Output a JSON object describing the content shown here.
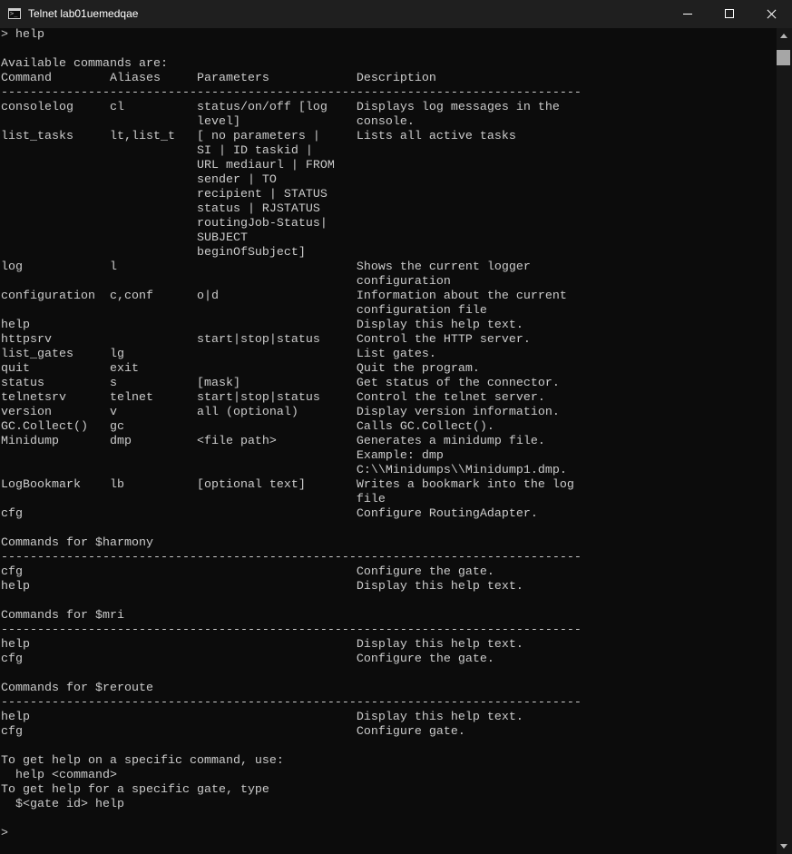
{
  "window": {
    "title": "Telnet lab01uemedqae",
    "app_icon": "console-icon",
    "controls": {
      "minimize": "minimize-icon",
      "maximize": "maximize-icon",
      "close": "close-icon"
    }
  },
  "terminal": {
    "background": "#0c0c0c",
    "foreground": "#cccccc",
    "lines": [
      "> help",
      "",
      "Available commands are:",
      "Command        Aliases     Parameters            Description",
      "--------------------------------------------------------------------------------",
      "consolelog     cl          status/on/off [log    Displays log messages in the",
      "                           level]                console.",
      "list_tasks     lt,list_t   [ no parameters |     Lists all active tasks",
      "                           SI | ID taskid |",
      "                           URL mediaurl | FROM",
      "                           sender | TO",
      "                           recipient | STATUS",
      "                           status | RJSTATUS",
      "                           routingJob-Status|",
      "                           SUBJECT",
      "                           beginOfSubject]",
      "log            l                                 Shows the current logger",
      "                                                 configuration",
      "configuration  c,conf      o|d                   Information about the current",
      "                                                 configuration file",
      "help                                             Display this help text.",
      "httpsrv                    start|stop|status     Control the HTTP server.",
      "list_gates     lg                                List gates.",
      "quit           exit                              Quit the program.",
      "status         s           [mask]                Get status of the connector.",
      "telnetsrv      telnet      start|stop|status     Control the telnet server.",
      "version        v           all (optional)        Display version information.",
      "GC.Collect()   gc                                Calls GC.Collect().",
      "Minidump       dmp         <file path>           Generates a minidump file.",
      "                                                 Example: dmp",
      "                                                 C:\\\\Minidumps\\\\Minidump1.dmp.",
      "LogBookmark    lb          [optional text]       Writes a bookmark into the log",
      "                                                 file",
      "cfg                                              Configure RoutingAdapter.",
      "",
      "Commands for $harmony",
      "--------------------------------------------------------------------------------",
      "cfg                                              Configure the gate.",
      "help                                             Display this help text.",
      "",
      "Commands for $mri",
      "--------------------------------------------------------------------------------",
      "help                                             Display this help text.",
      "cfg                                              Configure the gate.",
      "",
      "Commands for $reroute",
      "--------------------------------------------------------------------------------",
      "help                                             Display this help text.",
      "cfg                                              Configure gate.",
      "",
      "To get help on a specific command, use:",
      "  help <command>",
      "To get help for a specific gate, type",
      "  $<gate id> help",
      "",
      ">"
    ]
  },
  "scrollbar": {
    "up": "scroll-up-icon",
    "down": "scroll-down-icon",
    "position": 0.0
  }
}
